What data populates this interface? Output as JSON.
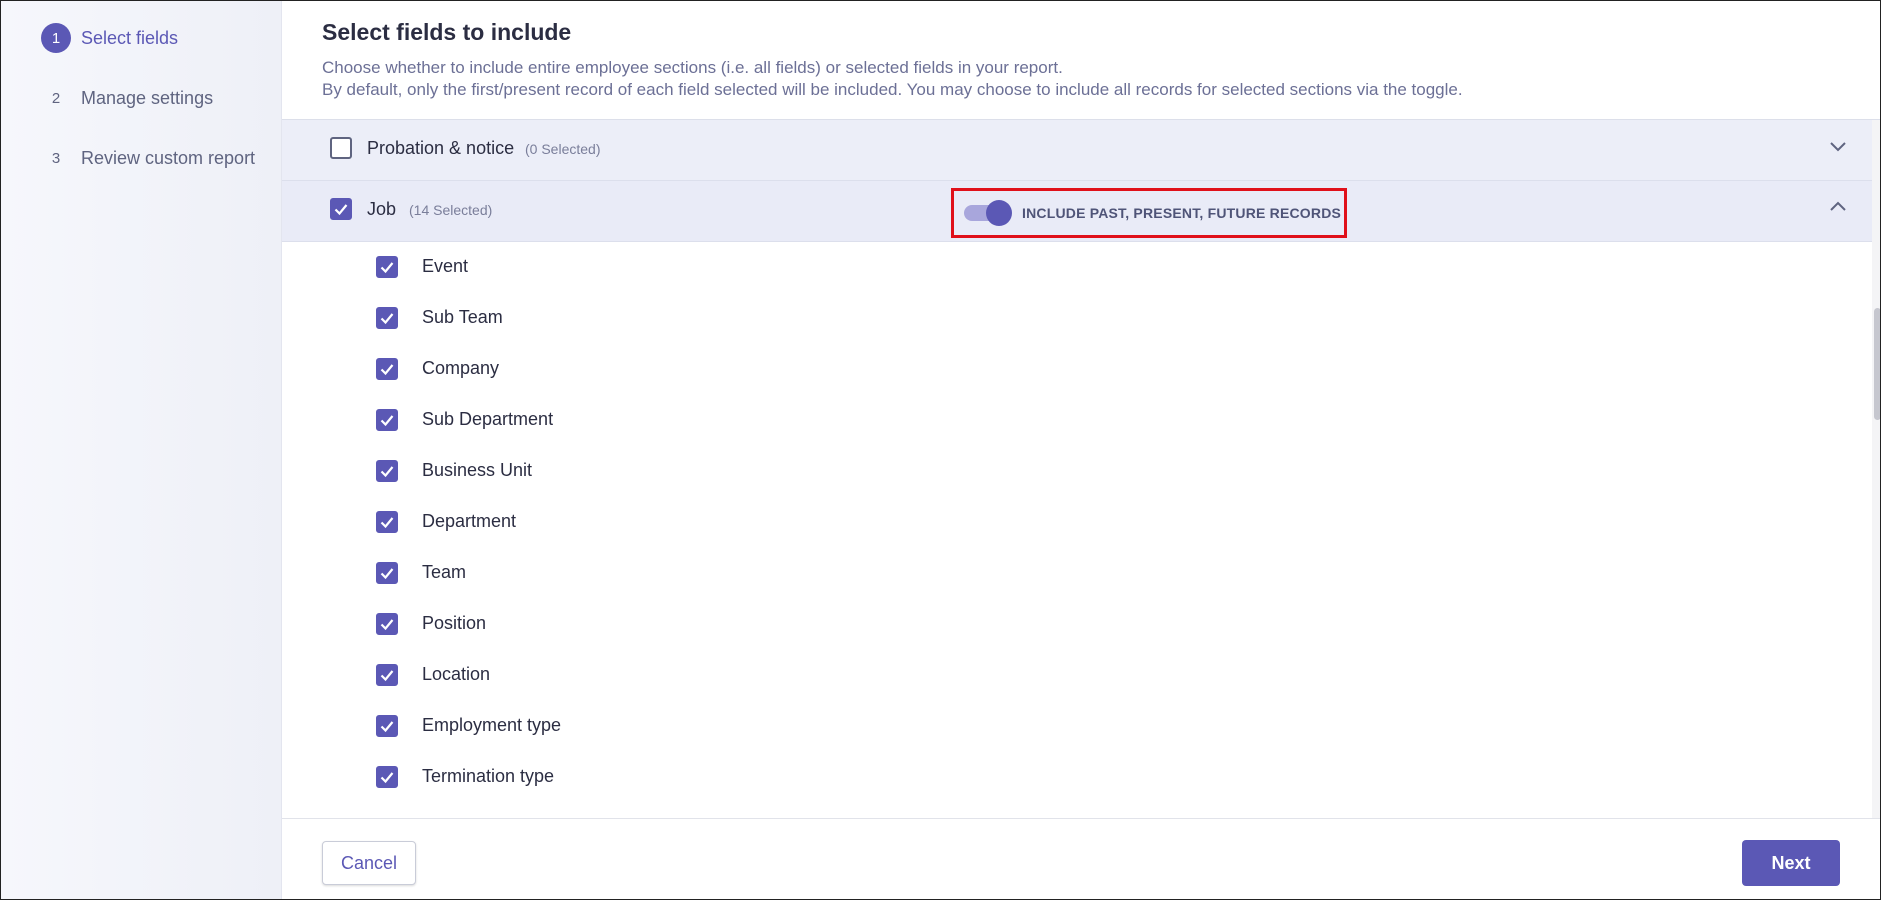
{
  "sidebar": {
    "steps": [
      {
        "number": "1",
        "label": "Select fields",
        "active": true
      },
      {
        "number": "2",
        "label": "Manage settings",
        "active": false
      },
      {
        "number": "3",
        "label": "Review custom report",
        "active": false
      }
    ]
  },
  "header": {
    "title": "Select fields to include",
    "description_line1": "Choose whether to include entire employee sections (i.e. all fields) or selected fields in your report.",
    "description_line2": "By default, only the first/present record of each field selected will be included. You may choose to include all records for selected sections via the toggle."
  },
  "sections": [
    {
      "label": "Probation & notice",
      "count": "(0 Selected)",
      "checked": false,
      "expanded": false
    },
    {
      "label": "Job",
      "count": "(14 Selected)",
      "checked": true,
      "expanded": true,
      "toggle_label": "INCLUDE PAST, PRESENT, FUTURE RECORDS",
      "toggle_on": true
    }
  ],
  "fields": [
    {
      "label": "Event",
      "checked": true
    },
    {
      "label": "Sub Team",
      "checked": true
    },
    {
      "label": "Company",
      "checked": true
    },
    {
      "label": "Sub Department",
      "checked": true
    },
    {
      "label": "Business Unit",
      "checked": true
    },
    {
      "label": "Department",
      "checked": true
    },
    {
      "label": "Team",
      "checked": true
    },
    {
      "label": "Position",
      "checked": true
    },
    {
      "label": "Location",
      "checked": true
    },
    {
      "label": "Employment type",
      "checked": true
    },
    {
      "label": "Termination type",
      "checked": true
    }
  ],
  "footer": {
    "cancel_label": "Cancel",
    "next_label": "Next"
  },
  "colors": {
    "accent": "#5b58b5",
    "highlight_border": "#e0101a",
    "section_bg": "#eceef8"
  }
}
